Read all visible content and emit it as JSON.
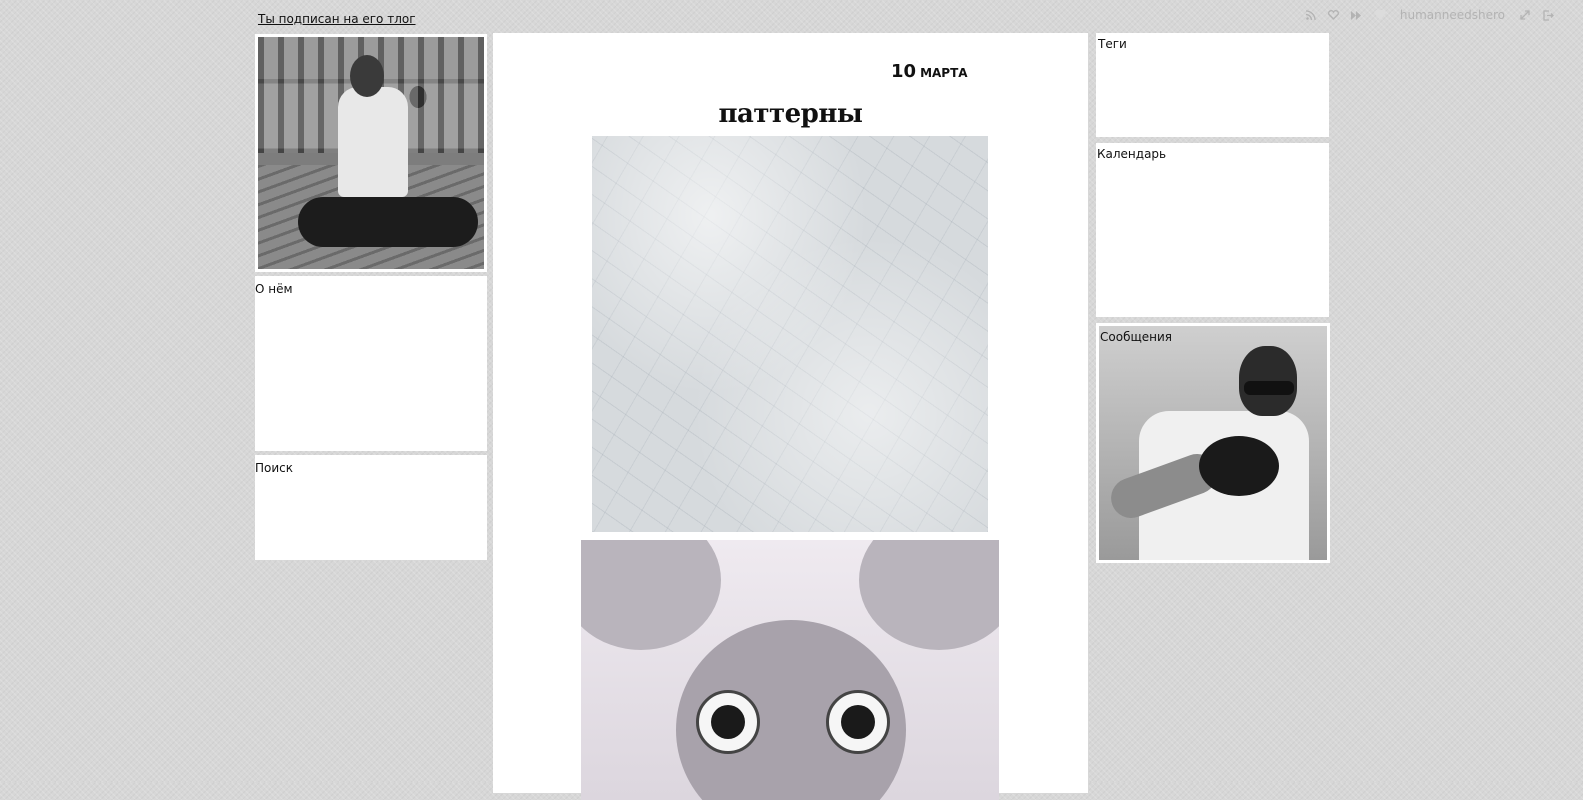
{
  "header": {
    "subscribed_link": "Ты подписан на его тлог",
    "username": "humanneedshero",
    "icons": [
      "rss-icon",
      "heart-icon",
      "forward-icon",
      "diamond-icon",
      "resize-icon",
      "logout-icon"
    ]
  },
  "sidebar_left": {
    "about_title": "О нём",
    "search_title": "Поиск"
  },
  "sidebar_right": {
    "tags_title": "Теги",
    "calendar_title": "Календарь",
    "messages_title": "Сообщения"
  },
  "post": {
    "day": "10",
    "month": "марта",
    "title": "паттерны"
  }
}
